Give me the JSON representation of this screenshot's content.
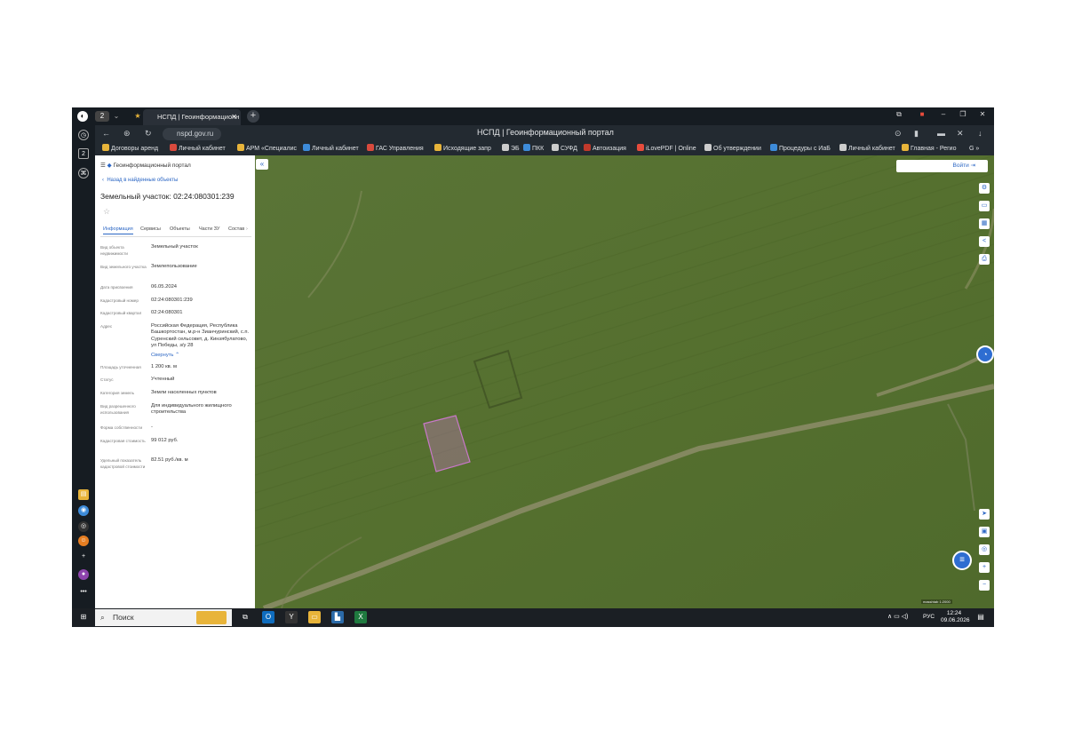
{
  "browser": {
    "tab_title": "НСПД | Геоинформационн",
    "tab_count": "2",
    "page_title": "НСПД | Геоинформационный портал",
    "url": "nspd.gov.ru"
  },
  "bookmarks": [
    {
      "label": "Договоры аренд",
      "color": "#e8b43a"
    },
    {
      "label": "Личный кабинет",
      "color": "#d94a3d"
    },
    {
      "label": "АРМ «Специалис",
      "color": "#e8b43a"
    },
    {
      "label": "Личный кабинет",
      "color": "#3d8bd9"
    },
    {
      "label": "ГАС Управления",
      "color": "#d94a3d"
    },
    {
      "label": "Исходящие запр",
      "color": "#e8b43a"
    },
    {
      "label": "ЭБ",
      "color": "#cccccc"
    },
    {
      "label": "ПКК",
      "color": "#3d8bd9"
    },
    {
      "label": "СУФД",
      "color": "#cccccc"
    },
    {
      "label": "Автоизация",
      "color": "#c0392b"
    },
    {
      "label": "iLovePDF | Online",
      "color": "#e74c3c"
    },
    {
      "label": "Об утверждении",
      "color": "#cccccc"
    },
    {
      "label": "Процедуры с ИаБ",
      "color": "#3d8bd9"
    },
    {
      "label": "Личный кабинет",
      "color": "#cccccc"
    },
    {
      "label": "Главная - Регио",
      "color": "#e8b43a"
    }
  ],
  "panel": {
    "header": "Геоинформационный портал",
    "back_link": "Назад в найденные объекты",
    "title": "Земельный участок: 02:24:080301:239",
    "star": "☆",
    "tabs": [
      "Информация",
      "Сервисы",
      "Объекты",
      "Части ЗУ",
      "Состав"
    ],
    "rows": [
      {
        "label": "Вид объекта недвижимости",
        "value": "Земельный участок"
      },
      {
        "label": "Вид земельного участка",
        "value": "Землепользование"
      },
      {
        "label": "Дата присвоения",
        "value": "06.05.2024"
      },
      {
        "label": "Кадастровый номер",
        "value": "02:24:080301:239"
      },
      {
        "label": "Кадастровый квартал",
        "value": "02:24:080301"
      },
      {
        "label": "Адрес",
        "value": "Российская Федерация, Республика Башкортостан, м.р-н Зианчуринский, с.п. Суренский сельсовет, д. Кинзябулатово, ул Победы, з/у 28"
      },
      {
        "label": "",
        "value": "Свернуть"
      },
      {
        "label": "Площадь уточненная",
        "value": "1 200 кв. м"
      },
      {
        "label": "Статус",
        "value": "Учтенный"
      },
      {
        "label": "Категория земель",
        "value": "Земли населенных пунктов"
      },
      {
        "label": "Вид разрешенного использования",
        "value": "Для индивидуального жилищного строительства"
      },
      {
        "label": "Форма собственности",
        "value": "-"
      },
      {
        "label": "Кадастровая стоимость",
        "value": "99 012 руб."
      },
      {
        "label": "Удельный показатель кадастровой стоимости",
        "value": "82.51 руб./кв. м"
      }
    ]
  },
  "map": {
    "login": "Войти",
    "scale": "masshtab 1:2000",
    "parcel_color": "#c878c8",
    "controls": [
      "⚙",
      "▭",
      "▦",
      "<",
      "⎙"
    ],
    "bottom_controls": [
      "➤",
      "▣",
      "◎",
      "+",
      "−"
    ]
  },
  "taskbar": {
    "search": "Поиск",
    "lang": "РУС",
    "time": "12:24",
    "date": "09.06.2026"
  }
}
